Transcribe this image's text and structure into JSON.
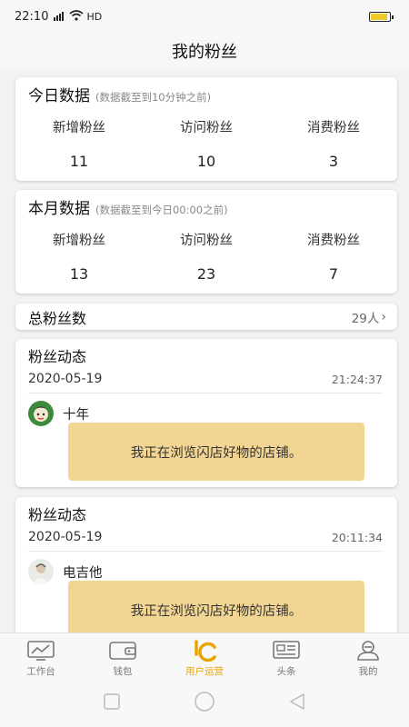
{
  "status_bar": {
    "time": "22:10",
    "network": "HD"
  },
  "header": {
    "title": "我的粉丝"
  },
  "today": {
    "title": "今日数据",
    "note": "(数据截至到10分钟之前)",
    "stats": [
      {
        "label": "新增粉丝",
        "value": "11"
      },
      {
        "label": "访问粉丝",
        "value": "10"
      },
      {
        "label": "消费粉丝",
        "value": "3"
      }
    ]
  },
  "month": {
    "title": "本月数据",
    "note": "(数据截至到今日00:00之前)",
    "stats": [
      {
        "label": "新增粉丝",
        "value": "13"
      },
      {
        "label": "访问粉丝",
        "value": "23"
      },
      {
        "label": "消费粉丝",
        "value": "7"
      }
    ]
  },
  "total": {
    "label": "总粉丝数",
    "count": "29人",
    "chevron": "›"
  },
  "dynamics": [
    {
      "title": "粉丝动态",
      "date": "2020-05-19",
      "time": "21:24:37",
      "user": "十年",
      "message": "我正在浏览闪店好物的店铺。"
    },
    {
      "title": "粉丝动态",
      "date": "2020-05-19",
      "time": "20:11:34",
      "user": "电吉他",
      "message": "我正在浏览闪店好物的店铺。"
    }
  ],
  "tabs": [
    {
      "label": "工作台",
      "icon": "monitor-chart-icon"
    },
    {
      "label": "钱包",
      "icon": "wallet-icon"
    },
    {
      "label": "用户运营",
      "icon": "user-operation-icon",
      "active": true
    },
    {
      "label": "头条",
      "icon": "news-icon"
    },
    {
      "label": "我的",
      "icon": "profile-icon"
    }
  ],
  "colors": {
    "accent": "#e8a500",
    "bubble": "#f2d592",
    "battery": "#f0c92b"
  }
}
